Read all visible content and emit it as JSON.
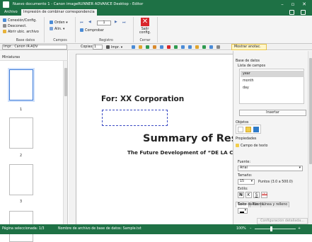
{
  "window": {
    "title": "Nuevo documento 1 - Canon imageRUNNER ADVANCE Desktop - Editor"
  },
  "tabs": [
    {
      "label": "Archivo"
    },
    {
      "label": "Impresión de combinar correspondencia"
    }
  ],
  "ribbon": {
    "datasource": {
      "items": [
        "Conexión/Config.",
        "Desconect.",
        "Abrir ubic. archivo"
      ],
      "label": "Base datos"
    },
    "fields": {
      "items": [
        "Orden",
        "Alin."
      ],
      "label": "Campos"
    },
    "record": {
      "value": "1",
      "compare": "Comprobar",
      "label": "Registro"
    },
    "close": {
      "button": "Salir config.",
      "label": "Cerrar"
    }
  },
  "toolbar": {
    "printer": "Impr.: Canon iR-ADV",
    "copies_label": "Copias:",
    "copies_value": "1",
    "print": "Impr.",
    "annotations": "Mostrar anotac."
  },
  "thumbnails": {
    "title": "Miniaturas",
    "pages": [
      "1",
      "2",
      "3"
    ]
  },
  "document": {
    "for_line": "For: XX Corporation",
    "title": "Summary of Rese",
    "subtitle": "The Future Development of “DE LA C"
  },
  "panel": {
    "datasource_title": "Base de datos",
    "fields_title": "Lista de campos",
    "fields": [
      "year",
      "month",
      "day"
    ],
    "insert": "Insertar",
    "objects_title": "Objetos",
    "properties_title": "Propiedades",
    "text_field": "Campo de texto",
    "subtabs": [
      "Texto",
      "Alin.",
      "Línea y relleno"
    ],
    "font_label": "Fuente:",
    "font_value": "Arial",
    "size_label": "Tamaño:",
    "size_value": "15",
    "size_range": "Puntos (3.0 a 500.0)",
    "style_label": "Estilo:",
    "style_buttons": [
      "N",
      "K",
      "S",
      "abc"
    ],
    "color_label": "Color de fuente:",
    "detail_button": "Configuración detallada..."
  },
  "status": {
    "selected": "Página seleccionada: 1/3",
    "datafile": "Nombre de archivo de base de datos: Sample.txt",
    "zoom": "100%"
  },
  "colors": {
    "brand": "#1e7145",
    "accent": "#3d7bd9"
  }
}
